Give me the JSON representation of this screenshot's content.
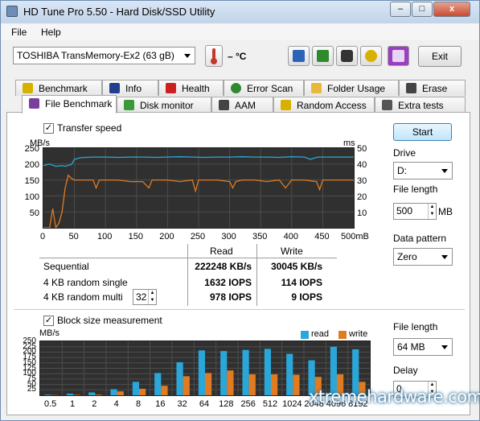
{
  "window": {
    "title": "HD Tune Pro 5.50 - Hard Disk/SSD Utility",
    "min_label": "–",
    "max_label": "□",
    "close_label": "x"
  },
  "menu": {
    "file": "File",
    "help": "Help"
  },
  "toolbar": {
    "drive_select": "TOSHIBA TransMemory-Ex2 (63 gB)",
    "temperature": "– °C",
    "exit_label": "Exit",
    "icons": [
      "copy-text-icon",
      "copy-screenshot-icon",
      "camera-icon",
      "options-icon",
      "save-icon"
    ]
  },
  "tabs_top": [
    {
      "label": "Benchmark",
      "icon": "benchmark-icon",
      "color": "#d8b100"
    },
    {
      "label": "Info",
      "icon": "info-icon",
      "color": "#213e8f"
    },
    {
      "label": "Health",
      "icon": "health-icon",
      "color": "#cc2020"
    },
    {
      "label": "Error Scan",
      "icon": "magnifier-icon",
      "color": "#2f8a2f"
    },
    {
      "label": "Folder Usage",
      "icon": "folder-icon",
      "color": "#e7b83a"
    },
    {
      "label": "Erase",
      "icon": "trash-icon",
      "color": "#444444"
    }
  ],
  "tabs_bottom": [
    {
      "label": "File Benchmark",
      "icon": "file-benchmark-icon",
      "color": "#7a3f9d"
    },
    {
      "label": "Disk monitor",
      "icon": "monitor-icon",
      "color": "#3a9a3a"
    },
    {
      "label": "AAM",
      "icon": "speaker-icon",
      "color": "#444444"
    },
    {
      "label": "Random Access",
      "icon": "random-icon",
      "color": "#d8b100"
    },
    {
      "label": "Extra tests",
      "icon": "grid-icon",
      "color": "#555555"
    }
  ],
  "transfer": {
    "checkbox_label": "Transfer speed",
    "y_unit_left": "MB/s",
    "y_unit_right": "ms",
    "y_ticks_left": [
      "250",
      "200",
      "150",
      "100",
      "50"
    ],
    "y_ticks_right": [
      "50",
      "40",
      "30",
      "20",
      "10"
    ],
    "x_ticks": [
      "0",
      "50",
      "100",
      "150",
      "200",
      "250",
      "300",
      "350",
      "400",
      "450",
      "500mB"
    ]
  },
  "results": {
    "col_read": "Read",
    "col_write": "Write",
    "rows": [
      {
        "label": "Sequential",
        "read": "222248 KB/s",
        "write": "30045 KB/s"
      },
      {
        "label": "4 KB random single",
        "read": "1632 IOPS",
        "write": "114 IOPS"
      },
      {
        "label": "4 KB random multi",
        "read": "978 IOPS",
        "write": "9 IOPS"
      }
    ],
    "multi_queue": "32"
  },
  "right_panel": {
    "start_label": "Start",
    "drive_label": "Drive",
    "drive_value": "D:",
    "file_length_label": "File length",
    "file_length_value": "500",
    "file_length_unit": "MB",
    "data_pattern_label": "Data pattern",
    "data_pattern_value": "Zero"
  },
  "block": {
    "checkbox_label": "Block size measurement",
    "y_unit": "MB/s",
    "legend_read": "read",
    "legend_write": "write",
    "file_length_label": "File length",
    "file_length_value": "64 MB",
    "delay_label": "Delay",
    "delay_value": "0"
  },
  "chart_data": [
    {
      "type": "line",
      "title": "Transfer speed",
      "xlabel": "mB",
      "ylabel": "MB/s",
      "ylim": [
        0,
        250
      ],
      "y2label": "ms",
      "y2lim": [
        0,
        50
      ],
      "xlim": [
        0,
        500
      ],
      "series": [
        {
          "name": "read",
          "axis": "left",
          "color": "#2aa7d8",
          "x": [
            0,
            10,
            20,
            30,
            35,
            40,
            45,
            50,
            60,
            80,
            100,
            120,
            140,
            160,
            180,
            200,
            220,
            240,
            260,
            280,
            300,
            320,
            340,
            360,
            380,
            400,
            420,
            430,
            440,
            445,
            450,
            500
          ],
          "y": [
            195,
            200,
            193,
            195,
            193,
            196,
            198,
            215,
            220,
            222,
            222,
            221,
            222,
            222,
            221,
            222,
            223,
            222,
            221,
            222,
            222,
            223,
            222,
            222,
            221,
            223,
            222,
            215,
            221,
            222,
            222,
            222
          ]
        },
        {
          "name": "write",
          "axis": "right",
          "color": "#e07b21",
          "x": [
            0,
            10,
            15,
            20,
            25,
            30,
            35,
            40,
            45,
            50,
            60,
            80,
            85,
            90,
            100,
            120,
            140,
            160,
            170,
            175,
            180,
            200,
            220,
            240,
            245,
            250,
            260,
            280,
            300,
            305,
            310,
            320,
            340,
            360,
            380,
            390,
            400,
            420,
            440,
            445,
            450,
            500
          ],
          "y": [
            0,
            0,
            12,
            0,
            3,
            10,
            25,
            33,
            31,
            30,
            30,
            30,
            25,
            30,
            30,
            30,
            29,
            29,
            25,
            30,
            30,
            30,
            29,
            30,
            23,
            30,
            30,
            30,
            29,
            25,
            29,
            30,
            30,
            29,
            30,
            25,
            30,
            30,
            29,
            24,
            30,
            30
          ]
        }
      ]
    },
    {
      "type": "bar",
      "title": "Block size measurement",
      "ylabel": "MB/s",
      "ylim": [
        0,
        250
      ],
      "y_ticks": [
        "250",
        "225",
        "200",
        "175",
        "150",
        "125",
        "100",
        "75",
        "50",
        "25"
      ],
      "categories": [
        "0.5",
        "1",
        "2",
        "4",
        "8",
        "16",
        "32",
        "64",
        "128",
        "256",
        "512",
        "1024",
        "2048",
        "4096",
        "8192"
      ],
      "series": [
        {
          "name": "read",
          "color": "#2aa7d8",
          "values": [
            3,
            7,
            13,
            28,
            62,
            103,
            153,
            208,
            205,
            210,
            215,
            192,
            162,
            225,
            213
          ]
        },
        {
          "name": "write",
          "color": "#e07b21",
          "values": [
            1,
            2,
            3,
            18,
            30,
            44,
            88,
            103,
            115,
            97,
            97,
            95,
            85,
            97,
            62
          ]
        }
      ]
    }
  ],
  "watermark": "xtremehardware.com"
}
